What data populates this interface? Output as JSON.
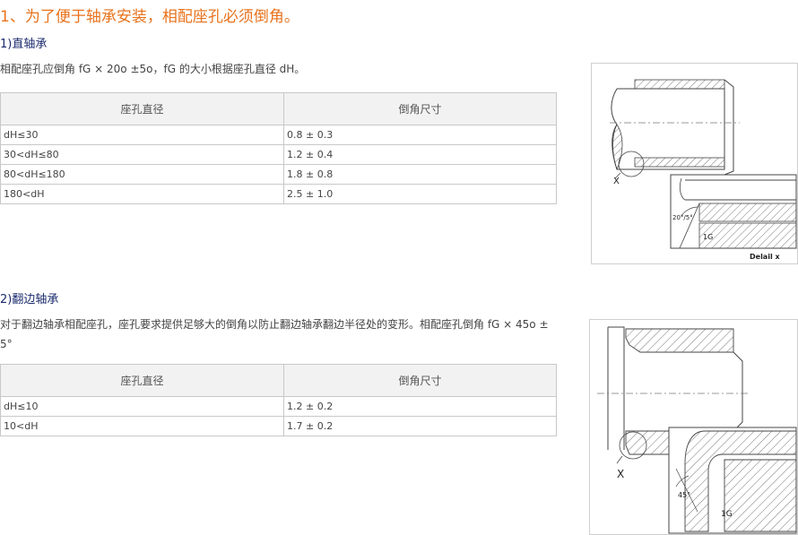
{
  "main_title": "1、为了便于轴承安装，相配座孔必须倒角。",
  "section1": {
    "title": "1)直轴承",
    "description": "相配座孔应倒角 fG × 20o ±5o，fG 的大小根据座孔直径 dH。",
    "table": {
      "headers": [
        "座孔直径",
        "倒角尺寸"
      ],
      "rows": [
        [
          "dH≤30",
          "0.8 ± 0.3"
        ],
        [
          "30<dH≤80",
          "1.2 ± 0.4"
        ],
        [
          "80<dH≤180",
          "1.8 ± 0.8"
        ],
        [
          "180<dH",
          "2.5 ± 1.0"
        ]
      ]
    },
    "figure": {
      "marker": "X",
      "angle_label": "20°/5°",
      "fg_label": "1G",
      "caption": "Delail x"
    }
  },
  "section2": {
    "title": "2)翻边轴承",
    "description": "对于翻边轴承相配座孔，座孔要求提供足够大的倒角以防止翻边轴承翻边半径处的变形。相配座孔倒角 fG × 45o ± 5°",
    "table": {
      "headers": [
        "座孔直径",
        "倒角尺寸"
      ],
      "rows": [
        [
          "dH≤10",
          "1.2 ± 0.2"
        ],
        [
          "10<dH",
          "1.7 ± 0.2"
        ]
      ]
    },
    "figure": {
      "marker": "X",
      "angle_label": "45°",
      "fg_label": "1G"
    }
  }
}
